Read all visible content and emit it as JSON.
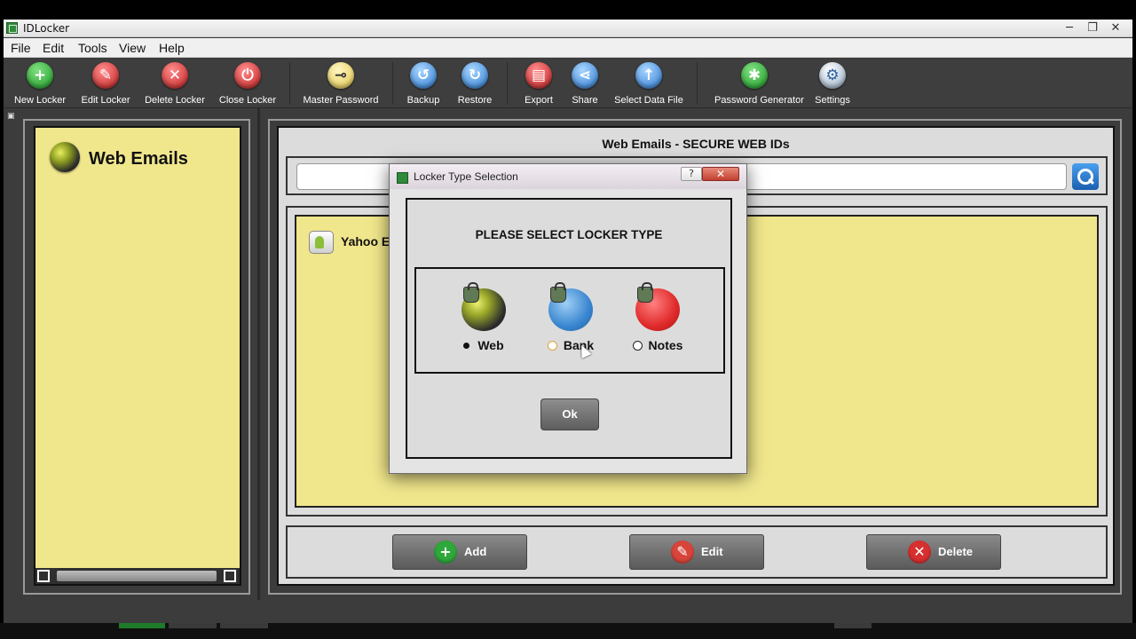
{
  "window": {
    "title": "IDLocker",
    "controls": [
      "─",
      "❐",
      "✕"
    ]
  },
  "menu": [
    "File",
    "Edit",
    "Tools",
    "View",
    "Help"
  ],
  "toolbar": [
    {
      "label": "New Locker",
      "icon": "plus-icon",
      "glyph": "+",
      "color": "green"
    },
    {
      "label": "Edit Locker",
      "icon": "pencil-icon",
      "glyph": "✎",
      "color": "red"
    },
    {
      "label": "Delete Locker",
      "icon": "delete-x-icon",
      "glyph": "✕",
      "color": "red"
    },
    {
      "label": "Close Locker",
      "icon": "power-icon",
      "glyph": "⏻",
      "color": "red"
    },
    {
      "label": "Master Password",
      "icon": "key-icon",
      "glyph": "⊸",
      "color": "yellow"
    },
    {
      "label": "Backup",
      "icon": "backup-icon",
      "glyph": "↺",
      "color": "blue"
    },
    {
      "label": "Restore",
      "icon": "restore-icon",
      "glyph": "↻",
      "color": "blue"
    },
    {
      "label": "Export",
      "icon": "export-icon",
      "glyph": "▤",
      "color": "red"
    },
    {
      "label": "Share",
      "icon": "share-icon",
      "glyph": "⋖",
      "color": "blue"
    },
    {
      "label": "Select Data File",
      "icon": "upload-arrow-icon",
      "glyph": "↑",
      "color": "blue"
    },
    {
      "label": "Password Generator",
      "icon": "password-generator-icon",
      "glyph": "✱",
      "color": "green"
    },
    {
      "label": "Settings",
      "icon": "settings-gear-icon",
      "glyph": "⚙",
      "color": "silver"
    }
  ],
  "sidebar": {
    "locker_label": "Web Emails"
  },
  "main": {
    "title": "Web Emails - SECURE WEB IDs",
    "search": {
      "value": "",
      "placeholder": ""
    },
    "entries": [
      {
        "label": "Yahoo E"
      }
    ],
    "actions": [
      {
        "label": "Add",
        "icon": "add-icon",
        "glyph": "+",
        "color": "#2ea83a"
      },
      {
        "label": "Edit",
        "icon": "edit-pencil-icon",
        "glyph": "✎",
        "color": "#d8443a"
      },
      {
        "label": "Delete",
        "icon": "delete-icon",
        "glyph": "✕",
        "color": "#d63030"
      }
    ]
  },
  "dialog": {
    "title": "Locker Type Selection",
    "help": "?",
    "close": "✕",
    "heading": "PLEASE SELECT LOCKER TYPE",
    "options": [
      {
        "label": "Web",
        "icon": "globe-lock-icon",
        "selected": true
      },
      {
        "label": "Bank",
        "icon": "bank-lock-icon",
        "selected": false
      },
      {
        "label": "Notes",
        "icon": "notes-lock-icon",
        "selected": false
      }
    ],
    "ok_label": "Ok"
  },
  "colors": {
    "panel_yellow": "#f0e68c",
    "toolbar_dark": "#3e3e3e",
    "accent_blue": "#2a78d0"
  }
}
